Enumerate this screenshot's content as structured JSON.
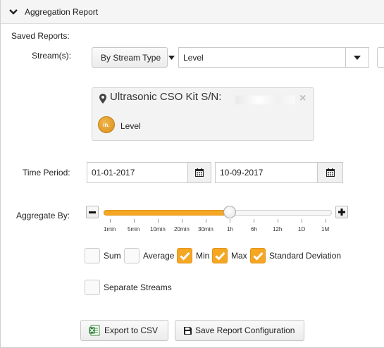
{
  "panel": {
    "title": "Aggregation Report"
  },
  "labels": {
    "saved_reports": "Saved Reports:",
    "streams": "Stream(s):",
    "time_period": "Time Period:",
    "aggregate_by": "Aggregate By:"
  },
  "stream_filter": {
    "type_button": "By Stream Type",
    "select_value": "Level"
  },
  "stream_card": {
    "title": "Ultrasonic CSO Kit S/N:",
    "badge": "in.",
    "stream_label": "Level"
  },
  "time_period": {
    "start": "01-01-2017",
    "end": "10-09-2017"
  },
  "aggregate": {
    "ticks": [
      "1min",
      "5min",
      "10min",
      "20min",
      "30min",
      "1h",
      "6h",
      "12h",
      "1D",
      "1M"
    ],
    "selected_index": 5,
    "selected_value": "1h"
  },
  "options": [
    {
      "label": "Sum",
      "checked": false
    },
    {
      "label": "Average",
      "checked": false
    },
    {
      "label": "Min",
      "checked": true
    },
    {
      "label": "Max",
      "checked": true
    },
    {
      "label": "Standard Deviation",
      "checked": true
    }
  ],
  "separate_streams": {
    "label": "Separate Streams",
    "checked": false
  },
  "actions": {
    "export_csv": "Export to CSV",
    "save_config": "Save Report Configuration"
  },
  "colors": {
    "accent": "#f5a623",
    "badge": "#e09a22"
  },
  "icons": [
    "chevron-down-icon",
    "map-pin-icon",
    "close-icon",
    "calendar-icon",
    "minus-icon",
    "plus-icon",
    "checkmark-icon",
    "excel-icon",
    "floppy-disk-icon",
    "caret-down-icon"
  ]
}
